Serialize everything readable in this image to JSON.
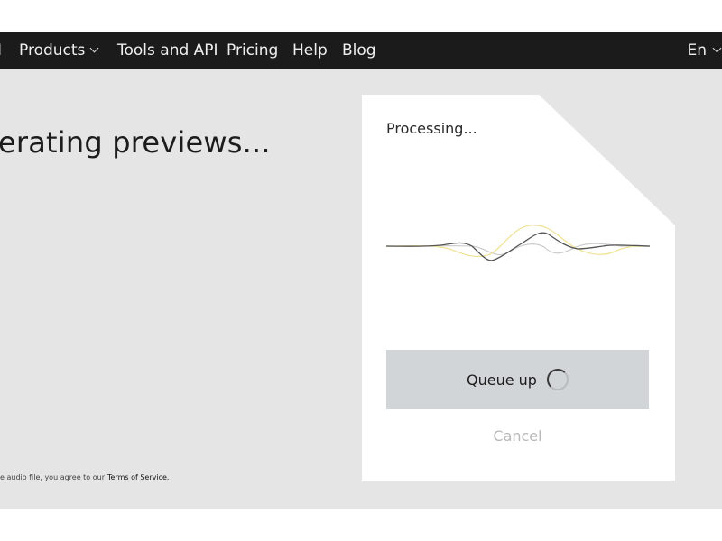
{
  "nav": {
    "brand_glyph": "I",
    "items": [
      {
        "label": "Products"
      },
      {
        "label": "Tools and API"
      },
      {
        "label": "Pricing"
      },
      {
        "label": "Help"
      },
      {
        "label": "Blog"
      }
    ],
    "language": "En"
  },
  "main": {
    "headline": "erating previews...",
    "legal_text": "e audio file, you agree to our",
    "terms_link": "Terms of Service."
  },
  "panel": {
    "status": "Processing...",
    "queue_button": "Queue up",
    "cancel_button": "Cancel"
  },
  "colors": {
    "nav_bg": "#1b1b1b",
    "page_bg": "#e5e5e5",
    "button_bg": "#d2d5d7",
    "wave_dark": "#555555",
    "wave_yellow": "#f0e49a",
    "wave_light": "#cccccc"
  }
}
